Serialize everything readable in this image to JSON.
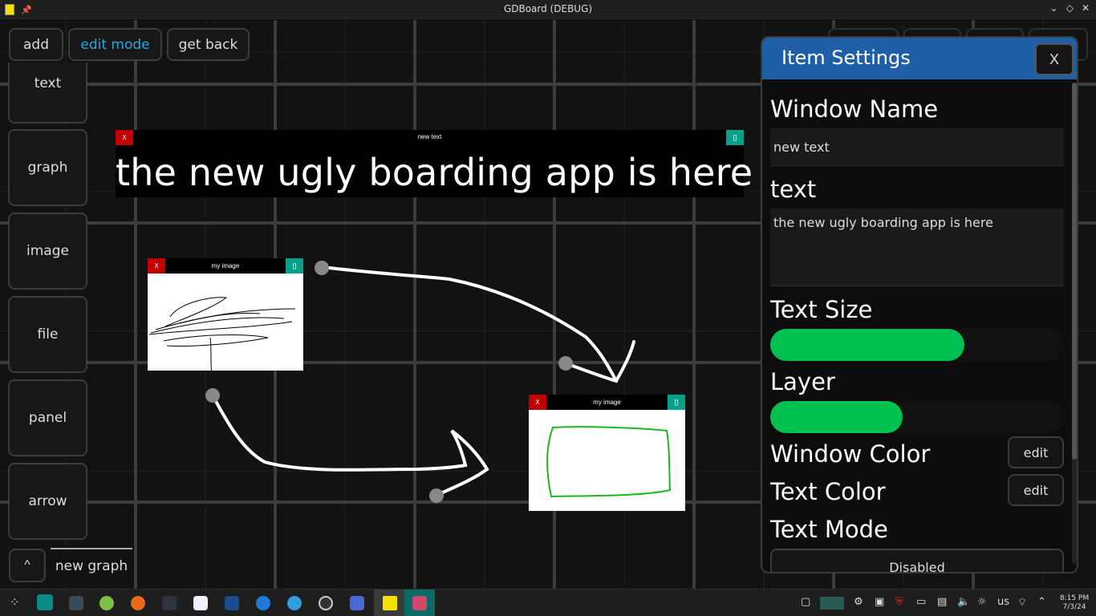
{
  "window": {
    "title": "GDBoard (DEBUG)"
  },
  "titlebar_icons": {
    "left": [
      "app-icon",
      "pin-icon"
    ],
    "right": [
      "chevron-down-icon",
      "diamond-icon",
      "close-icon"
    ]
  },
  "toolbar": {
    "add": "add",
    "edit_mode": "edit mode",
    "get_back": "get back"
  },
  "sidebar": {
    "items": [
      "text",
      "graph",
      "image",
      "file",
      "panel",
      "arrow"
    ]
  },
  "bottom": {
    "caret": "^",
    "new_graph": "new graph"
  },
  "board": {
    "text_window": {
      "title": "new text",
      "close": "X",
      "max": "[]",
      "content": "the new ugly boarding app is here"
    },
    "image_window_1": {
      "title": "my image",
      "close": "X",
      "max": "[]"
    },
    "image_window_2": {
      "title": "my image",
      "close": "X",
      "max": "[]"
    }
  },
  "settings": {
    "title": "Item Settings",
    "close": "X",
    "window_name_label": "Window Name",
    "window_name_value": "new text",
    "text_label": "text",
    "text_value": "the new ugly boarding app is here",
    "text_size_label": "Text Size",
    "text_size_level": 0.66,
    "layer_label": "Layer",
    "layer_level": 0.45,
    "window_color_label": "Window Color",
    "text_color_label": "Text Color",
    "edit": "edit",
    "text_mode_label": "Text Mode",
    "text_mode_value": "Disabled"
  },
  "colors": {
    "accent": "#2aa7e0",
    "header": "#1f5fa8",
    "slider": "#00c050",
    "close": "#c00000",
    "max": "#08a08a",
    "stroke_green": "#1db81d"
  },
  "tray": {
    "keyboard": "us",
    "time": "8:15 PM",
    "date": "7/3/24"
  }
}
